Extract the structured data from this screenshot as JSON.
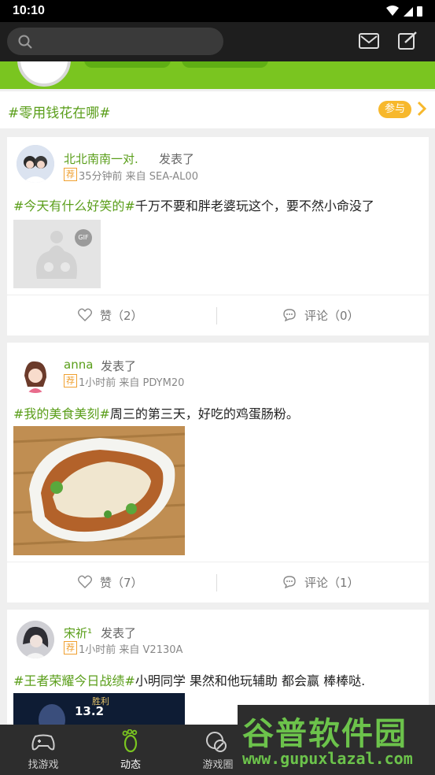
{
  "status": {
    "time": "10:10"
  },
  "search": {
    "placeholder": ""
  },
  "topic": {
    "title": "#零用钱花在哪#",
    "join_label": "参与"
  },
  "posts": [
    {
      "username": "北北南南一对.",
      "posted": "发表了",
      "badge": "荐",
      "meta": "35分钟前  来自 SEA-AL00",
      "tag": "#今天有什么好笑的#",
      "text": "千万不要和胖老婆玩这个，要不然小命没了",
      "image_badge": "GIF",
      "like_label": "赞（2）",
      "comment_label": "评论（0）"
    },
    {
      "username": "anna",
      "posted": "发表了",
      "badge": "荐",
      "meta": "1小时前  来自 PDYM20",
      "tag": "#我的美食美刻#",
      "text": "周三的第三天，好吃的鸡蛋肠粉。",
      "like_label": "赞（7）",
      "comment_label": "评论（1）"
    },
    {
      "username": "宋祈¹",
      "posted": "发表了",
      "badge": "荐",
      "meta": "1小时前  来自 V2130A",
      "tag": "#王者荣耀今日战绩#",
      "text": "小明同学 果然和他玩辅助 都会赢 棒棒哒.",
      "image_text_1": "胜利",
      "image_text_2": "13.2"
    }
  ],
  "nav": {
    "items": [
      {
        "label": "找游戏",
        "icon": "gamepad-icon"
      },
      {
        "label": "动态",
        "icon": "footprint-icon"
      },
      {
        "label": "游戏圈",
        "icon": "circle-icon"
      }
    ]
  },
  "watermark": {
    "logo": "谷普软件园",
    "url": "www.gupuxlazal.com"
  },
  "colors": {
    "accent": "#7ac520",
    "tag": "#5a9e1a",
    "badge": "#f0a030",
    "join": "#f7b82c"
  }
}
